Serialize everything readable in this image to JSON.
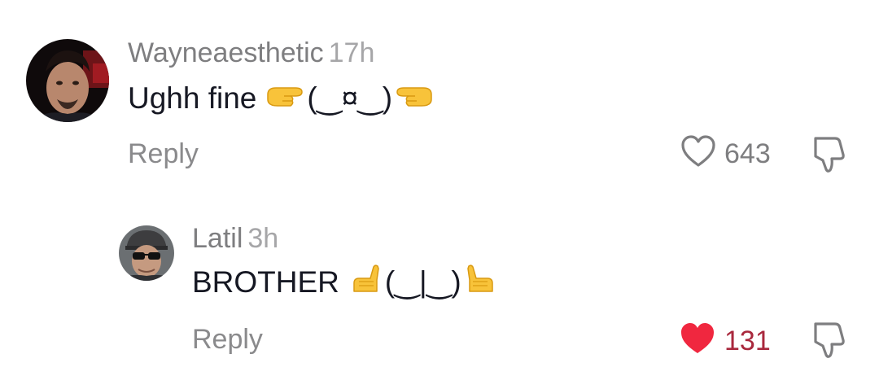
{
  "comments": [
    {
      "username": "Wayneaesthetic",
      "time": "17h",
      "text_prefix": "Ughh fine",
      "kaomoji": "(‿¤‿)",
      "reply_label": "Reply",
      "like_count": "643",
      "liked": false,
      "avatar_icon": "user-photo-avatar",
      "hand_icons": [
        "point-right-hand-icon",
        "point-left-hand-icon"
      ]
    },
    {
      "username": "Latil",
      "time": "3h",
      "text_prefix": "BROTHER",
      "kaomoji": "(‿|‿)",
      "reply_label": "Reply",
      "like_count": "131",
      "liked": true,
      "avatar_icon": "user-photo-avatar",
      "hand_icons": [
        "raised-hand-palm-left-icon",
        "raised-hand-palm-right-icon"
      ]
    }
  ],
  "colors": {
    "username": "#7e7e80",
    "text": "#161823",
    "like_active": "#fe2c55",
    "like_count_active": "#a9283d",
    "icon_gray": "#8a8a8c",
    "emoji_yellow": "#f8c33a"
  }
}
